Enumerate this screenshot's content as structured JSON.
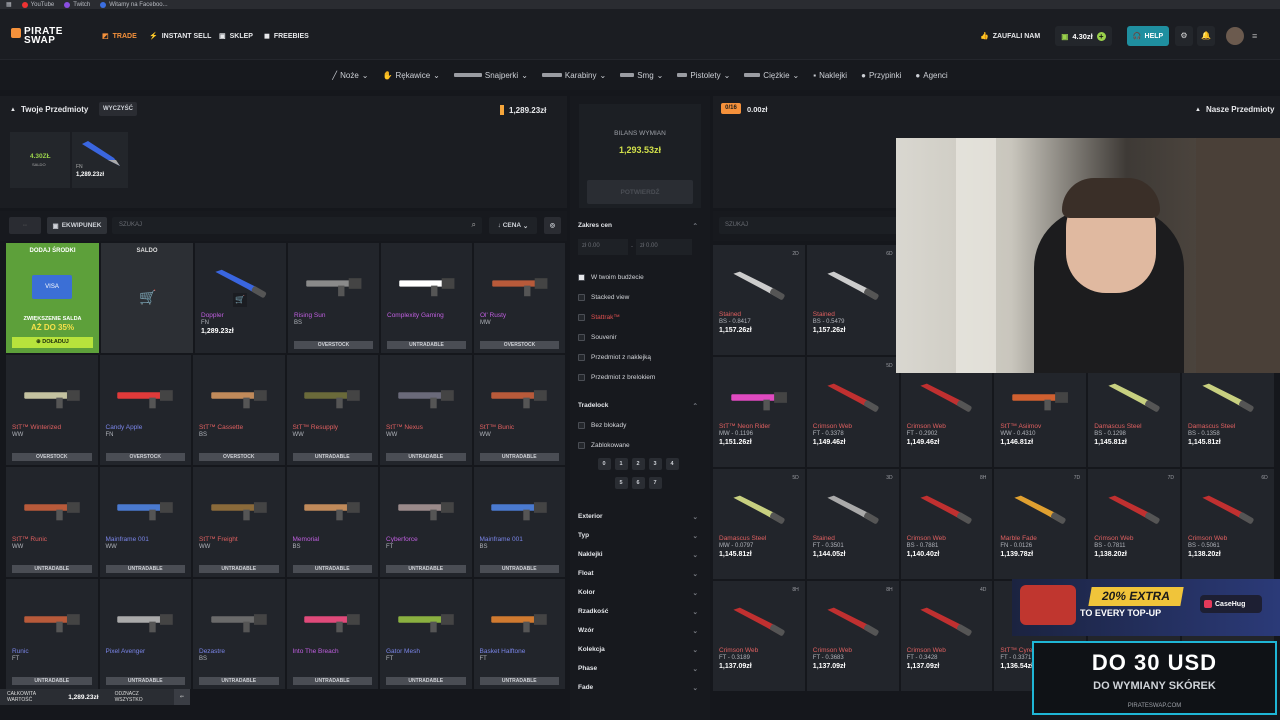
{
  "bookmarks": [
    "YouTube",
    "Twitch",
    "Witamy na Faceboo..."
  ],
  "logo": {
    "line1": "PIRATE",
    "line2": "SWAP"
  },
  "nav": {
    "trade": "TRADE",
    "instant_sell": "INSTANT SELL",
    "shop": "SKLEP",
    "freebies": "FREEBIES",
    "trusted": "ZAUFALI NAM",
    "balance": "4.30zł",
    "help": "HELP"
  },
  "categories": [
    "Noże",
    "Rękawice",
    "Snajperki",
    "Karabiny",
    "Smg",
    "Pistolety",
    "Ciężkie",
    "Naklejki",
    "Przypinki",
    "Agenci"
  ],
  "left": {
    "title": "Twoje Przedmioty",
    "clear": "WYCZYŚĆ",
    "total": "1,289.23zł",
    "saldo": {
      "value": "4.30ZŁ",
      "label": "SALDO"
    },
    "selected": {
      "cond": "FN",
      "price": "1,289.23zł"
    },
    "tab_inventory": "EKWIPUNEK",
    "search_placeholder": "SZUKAJ",
    "sort": "CENA",
    "promo": {
      "top": "DODAJ ŚRODKI",
      "bonus_line1": "ZWIĘKSZENIE SALDA",
      "bonus_line2": "AŻ DO 35%",
      "btn": "DOŁADUJ"
    },
    "saldo_card": "SALDO",
    "items": [
      {
        "name": "Doppler",
        "wear": "FN",
        "price": "1,289.23zł",
        "c": "p",
        "bar": ""
      },
      {
        "name": "Rising Sun",
        "wear": "BS",
        "price": "",
        "c": "p",
        "bar": "OVERSTOCK"
      },
      {
        "name": "Complexity Gaming",
        "wear": "",
        "price": "",
        "c": "p",
        "bar": "UNTRADABLE"
      },
      {
        "name": "Ol' Rusty",
        "wear": "MW",
        "price": "",
        "c": "p",
        "bar": "OVERSTOCK"
      },
      {
        "name": "StT™ Winterized",
        "wear": "WW",
        "price": "",
        "c": "",
        "bar": "OVERSTOCK"
      },
      {
        "name": "Candy Apple",
        "wear": "FN",
        "price": "",
        "c": "b",
        "bar": "OVERSTOCK"
      },
      {
        "name": "StT™ Cassette",
        "wear": "BS",
        "price": "",
        "c": "",
        "bar": "OVERSTOCK"
      },
      {
        "name": "StT™ Resupply",
        "wear": "WW",
        "price": "",
        "c": "",
        "bar": "UNTRADABLE"
      },
      {
        "name": "StT™ Nexus",
        "wear": "WW",
        "price": "",
        "c": "",
        "bar": "UNTRADABLE"
      },
      {
        "name": "StT™ Bunic",
        "wear": "WW",
        "price": "",
        "c": "",
        "bar": "UNTRADABLE"
      },
      {
        "name": "StT™ Runic",
        "wear": "WW",
        "price": "",
        "c": "",
        "bar": "UNTRADABLE"
      },
      {
        "name": "Mainframe 001",
        "wear": "WW",
        "price": "",
        "c": "b",
        "bar": "UNTRADABLE"
      },
      {
        "name": "StT™ Freight",
        "wear": "WW",
        "price": "",
        "c": "",
        "bar": "UNTRADABLE"
      },
      {
        "name": "Memorial",
        "wear": "BS",
        "price": "",
        "c": "p",
        "bar": "UNTRADABLE"
      },
      {
        "name": "Cyberforce",
        "wear": "FT",
        "price": "",
        "c": "p",
        "bar": "UNTRADABLE"
      },
      {
        "name": "Mainframe 001",
        "wear": "BS",
        "price": "",
        "c": "b",
        "bar": "UNTRADABLE"
      },
      {
        "name": "Runic",
        "wear": "FT",
        "price": "",
        "c": "b",
        "bar": "UNTRADABLE"
      },
      {
        "name": "Pixel Avenger",
        "wear": "",
        "price": "",
        "c": "b",
        "bar": "UNTRADABLE"
      },
      {
        "name": "Dezastre",
        "wear": "BS",
        "price": "",
        "c": "b",
        "bar": "UNTRADABLE"
      },
      {
        "name": "Into The Breach",
        "wear": "",
        "price": "",
        "c": "p",
        "bar": "UNTRADABLE"
      },
      {
        "name": "Gator Mesh",
        "wear": "FT",
        "price": "",
        "c": "b",
        "bar": "UNTRADABLE"
      },
      {
        "name": "Basket Halftone",
        "wear": "FT",
        "price": "",
        "c": "b",
        "bar": "UNTRADABLE"
      }
    ],
    "footer": {
      "total_label": "CAŁKOWITA WARTOŚĆ",
      "total": "1,289.23zł",
      "deselect": "ODZNACZ WSZYSTKO"
    }
  },
  "middle": {
    "balance_label": "BILANS WYMIAN",
    "balance": "1,293.53zł",
    "confirm": "POTWIERDŹ",
    "price_range": "Zakres cen",
    "from": "zł 0.00",
    "to": "zł 0.00",
    "options": [
      "W twoim budżecie",
      "Stacked view",
      "Stattrak™",
      "Souvenir",
      "Przedmiot z naklejką",
      "Przedmiot z brelokiem"
    ],
    "tradelock": "Tradelock",
    "lock_opts": [
      "Bez blokady",
      "Zablokowane"
    ],
    "days_row1": [
      "0",
      "1",
      "2",
      "3",
      "4"
    ],
    "days_row2": [
      "5",
      "6",
      "7"
    ],
    "accordions": [
      "Exterior",
      "Typ",
      "Naklejki",
      "Float",
      "Kolor",
      "Rzadkość",
      "Wzór",
      "Kolekcja",
      "Phase",
      "Fade"
    ]
  },
  "right": {
    "counter": "0/16",
    "value": "0.00zł",
    "title": "Nasze Przedmioty",
    "search_placeholder": "SZUKAJ",
    "items": [
      {
        "name": "Stained",
        "wear": "BS - 0.8417",
        "price": "1,157.26zł",
        "tag": "2D"
      },
      {
        "name": "Stained",
        "wear": "BS - 0.5479",
        "price": "1,157.26zł",
        "tag": "6D"
      },
      {
        "name": "",
        "wear": "",
        "price": "",
        "tag": ""
      },
      {
        "name": "",
        "wear": "",
        "price": "",
        "tag": ""
      },
      {
        "name": "",
        "wear": "",
        "price": "",
        "tag": ""
      },
      {
        "name": "",
        "wear": "",
        "price": "",
        "tag": ""
      },
      {
        "name": "StT™ Neon Rider",
        "wear": "MW - 0.1196",
        "price": "1,151.26zł",
        "tag": ""
      },
      {
        "name": "Crimson Web",
        "wear": "FT - 0.3378",
        "price": "1,149.46zł",
        "tag": "5D"
      },
      {
        "name": "Crimson Web",
        "wear": "FT - 0.2902",
        "price": "1,149.46zł",
        "tag": "8H"
      },
      {
        "name": "StT™ Asiimov",
        "wear": "WW - 0.4310",
        "price": "1,146.81zł",
        "tag": ""
      },
      {
        "name": "Damascus Steel",
        "wear": "BS - 0.1298",
        "price": "1,145.81zł",
        "tag": ""
      },
      {
        "name": "Damascus Steel",
        "wear": "BS - 0.1358",
        "price": "1,145.81zł",
        "tag": ""
      },
      {
        "name": "Damascus Steel",
        "wear": "MW - 0.0797",
        "price": "1,145.81zł",
        "tag": "5D"
      },
      {
        "name": "Stained",
        "wear": "FT - 0.3501",
        "price": "1,144.05zł",
        "tag": "3D"
      },
      {
        "name": "Crimson Web",
        "wear": "BS - 0.7881",
        "price": "1,140.40zł",
        "tag": "8H"
      },
      {
        "name": "Marble Fade",
        "wear": "FN - 0.0126",
        "price": "1,139.78zł",
        "tag": "7D"
      },
      {
        "name": "Crimson Web",
        "wear": "BS - 0.7811",
        "price": "1,138.20zł",
        "tag": "7D"
      },
      {
        "name": "Crimson Web",
        "wear": "BS - 0.5061",
        "price": "1,138.20zł",
        "tag": "6D"
      },
      {
        "name": "Crimson Web",
        "wear": "FT - 0.3189",
        "price": "1,137.09zł",
        "tag": "8H"
      },
      {
        "name": "Crimson Web",
        "wear": "FT - 0.3683",
        "price": "1,137.09zł",
        "tag": "8H"
      },
      {
        "name": "Crimson Web",
        "wear": "FT - 0.3428",
        "price": "1,137.09zł",
        "tag": "4D"
      },
      {
        "name": "StT™ Cyrex",
        "wear": "FT - 0.3371",
        "price": "1,136.54zł",
        "tag": ""
      },
      {
        "name": "",
        "wear": "",
        "price": "",
        "tag": ""
      },
      {
        "name": "",
        "wear": "",
        "price": "",
        "tag": ""
      }
    ]
  },
  "ad1": {
    "line1": "20% EXTRA",
    "line2": "TO EVERY TOP-UP",
    "brand": "CaseHug"
  },
  "ad2": {
    "big": "DO 30 USD",
    "sub": "DO WYMIANY SKÓREK",
    "url": "PIRATESWAP.COM"
  },
  "colors": {
    "accent": "#f5913b",
    "green": "#9ad14b",
    "help": "#1f8fa0"
  }
}
